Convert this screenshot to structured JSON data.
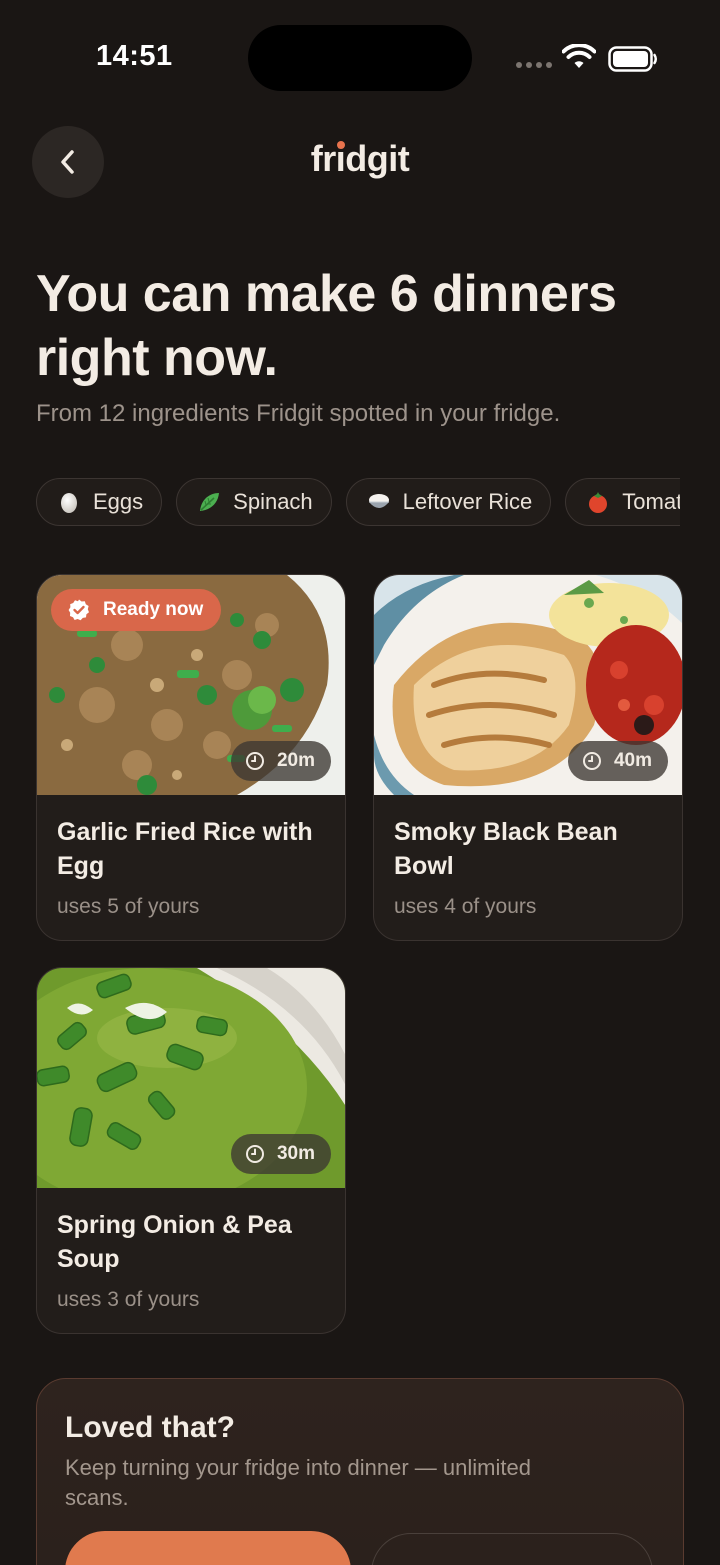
{
  "status_bar": {
    "time": "14:51"
  },
  "header": {
    "logo_prefix": "fr",
    "logo_dot_letter": "i",
    "logo_suffix": "dgit"
  },
  "headline": "You can make 6 dinners right now.",
  "subheadline": "From 12 ingredients Fridgit spotted in your fridge.",
  "ingredient_chips": [
    {
      "label": "Eggs",
      "icon": "egg-icon"
    },
    {
      "label": "Spinach",
      "icon": "spinach-icon"
    },
    {
      "label": "Leftover Rice",
      "icon": "rice-bowl-icon"
    },
    {
      "label": "Tomatoes",
      "icon": "tomato-icon"
    }
  ],
  "recipes": [
    {
      "title": "Garlic Fried Rice with Egg",
      "uses": "uses 5 of yours",
      "time": "20m",
      "badge": "Ready now"
    },
    {
      "title": "Smoky Black Bean Bowl",
      "uses": "uses 4 of yours",
      "time": "40m"
    },
    {
      "title": "Spring Onion & Pea Soup",
      "uses": "uses 3 of yours",
      "time": "30m"
    }
  ],
  "promo": {
    "title": "Loved that?",
    "text": "Keep turning your fridge into dinner — unlimited scans."
  },
  "colors": {
    "accent": "#e07a4e",
    "background": "#1a1614",
    "card": "#221d1a"
  }
}
